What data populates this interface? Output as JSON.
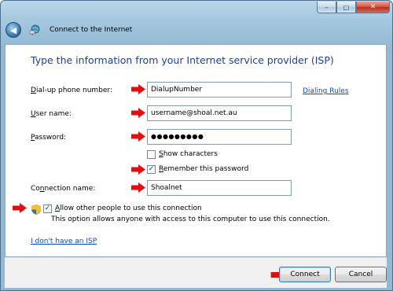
{
  "window": {
    "title": "Connect to the Internet",
    "caption": {
      "minimize": "–",
      "maximize": "□",
      "close": "✕"
    }
  },
  "nav": {
    "back_glyph": "◀"
  },
  "main": {
    "heading": "Type the information from your Internet service provider (ISP)",
    "fields": {
      "dialup": {
        "label_key": "D",
        "label_rest": "ial-up phone number:",
        "value": "DialupNumber"
      },
      "username": {
        "label_key": "U",
        "label_rest": "ser name:",
        "value": "username@shoal.net.au"
      },
      "password": {
        "label_key": "P",
        "label_rest": "assword:",
        "value": "●●●●●●●●●"
      },
      "connection": {
        "label_pre": "Co",
        "label_key": "n",
        "label_rest": "nection name:",
        "value": "Shoalnet"
      }
    },
    "dialing_rules": "Dialing Rules",
    "show_chars": {
      "key": "S",
      "rest": "how characters",
      "checked": false
    },
    "remember": {
      "key": "R",
      "rest": "emember this password",
      "checked": true
    },
    "allow_others": {
      "key": "A",
      "rest": "llow other people to use this connection",
      "checked": true
    },
    "allow_desc": "This option allows anyone with access to this computer to use this connection.",
    "no_isp": "I don't have an ISP",
    "check_glyph": "✓"
  },
  "footer": {
    "connect": "Connect",
    "cancel": "Cancel"
  },
  "colors": {
    "arrow": "#e01010",
    "heading": "#1f3f8f",
    "link": "#0a4fb7"
  },
  "icons": [
    "back-arrow-icon",
    "network-globe-icon",
    "red-arrow-icon",
    "uac-shield-icon",
    "checkmark-icon"
  ]
}
